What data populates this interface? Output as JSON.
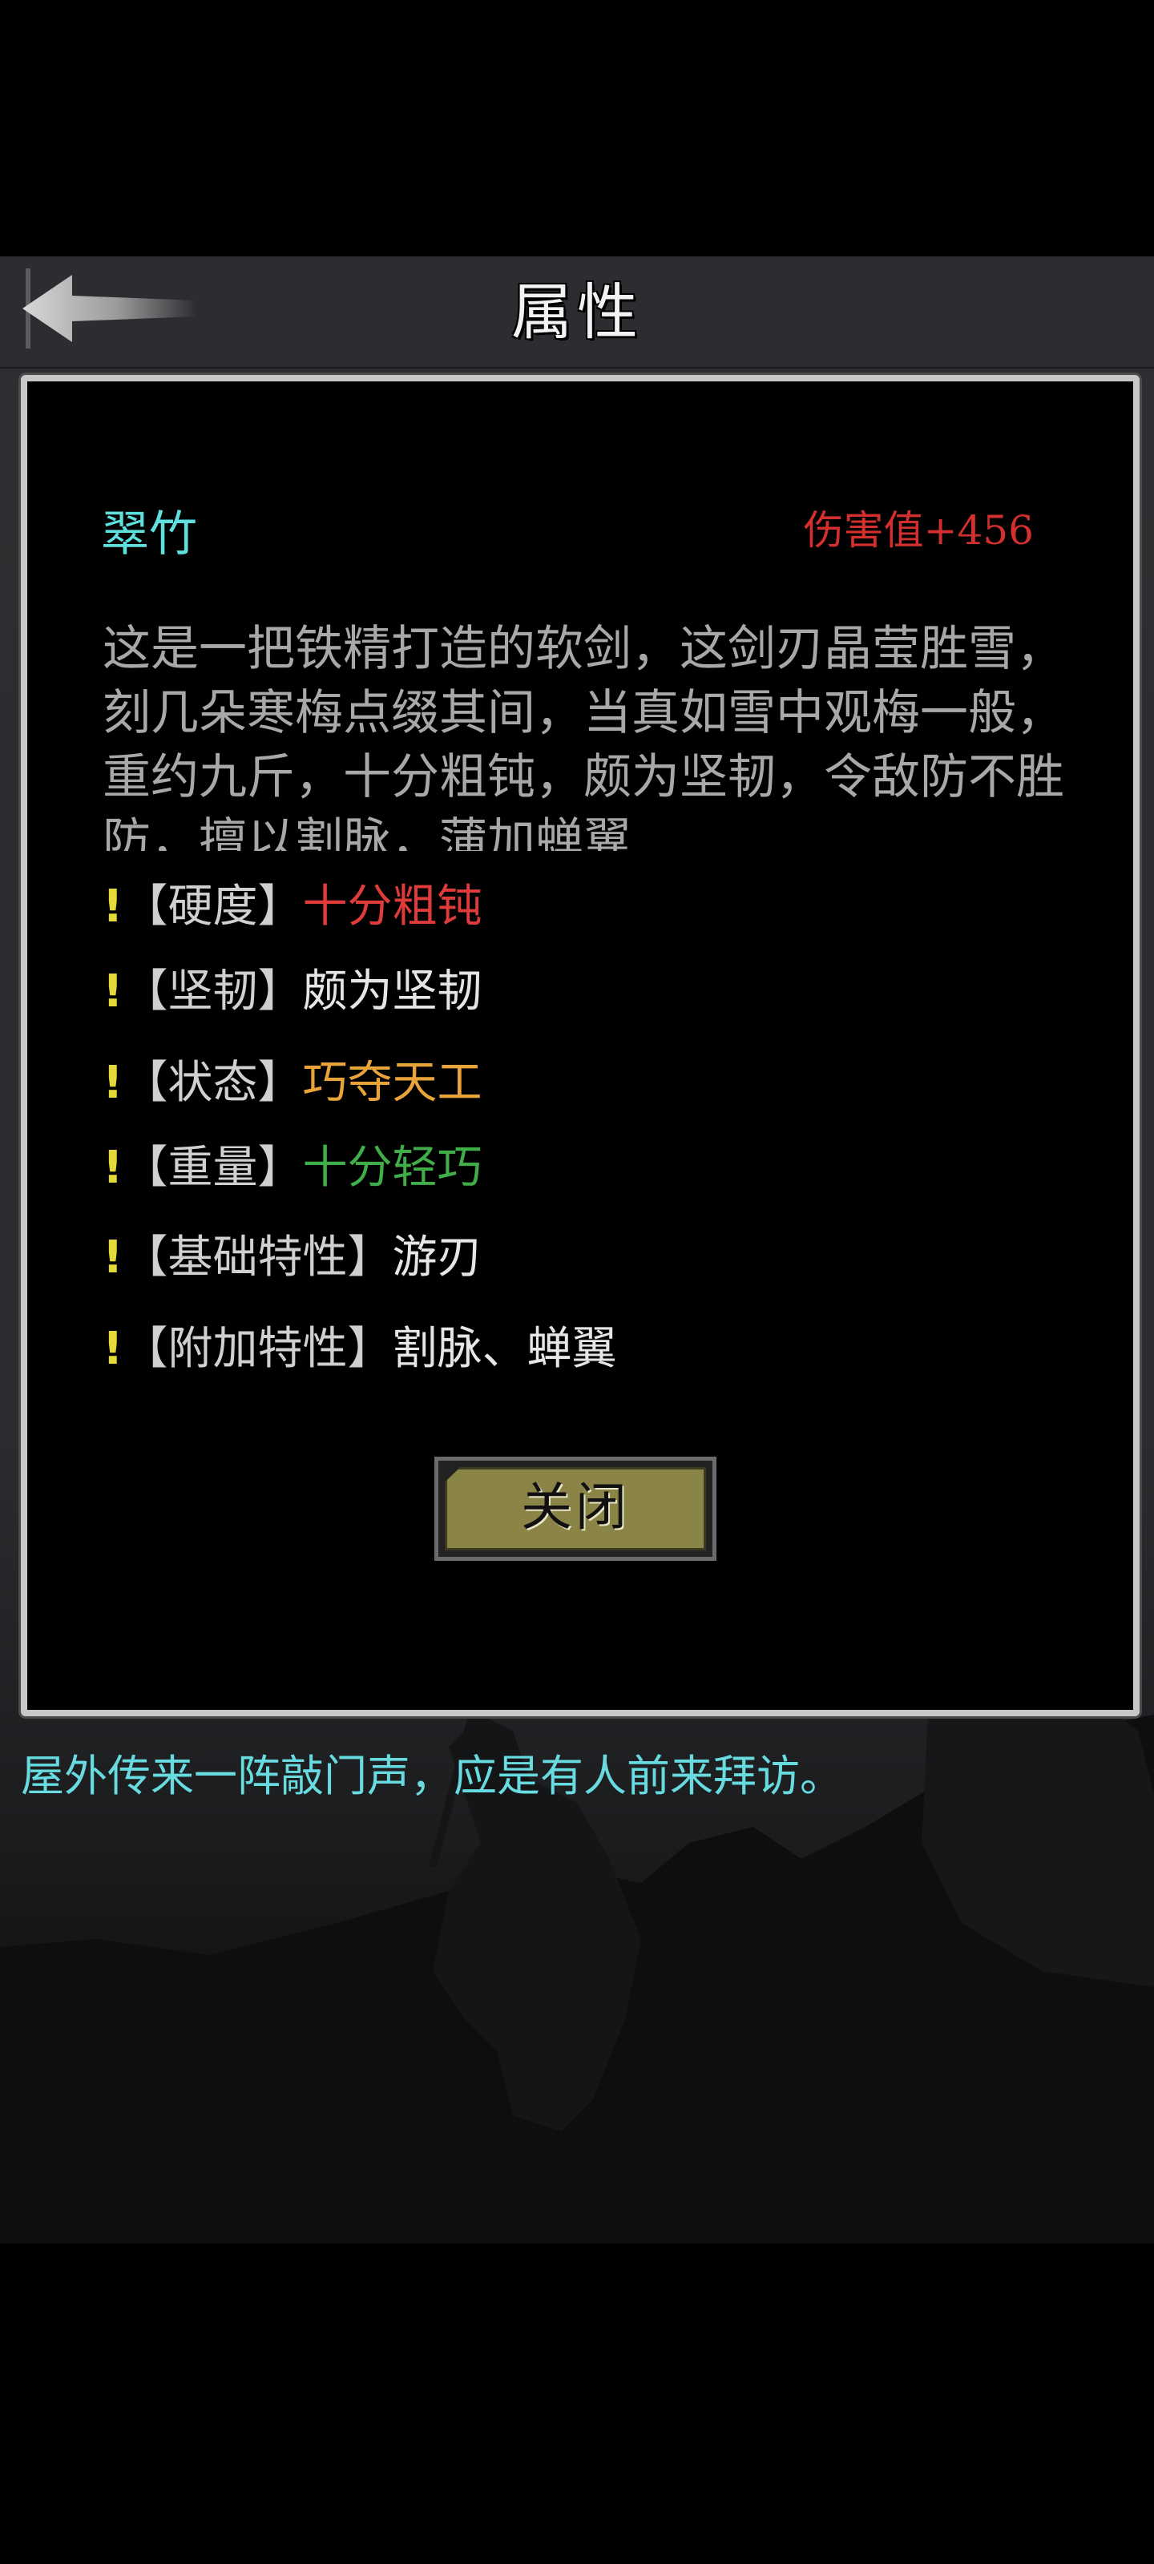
{
  "header": {
    "title": "属性"
  },
  "item": {
    "name": "翠竹",
    "damage": "伤害值+456",
    "description": "这是一把铁精打造的软剑，这剑刃晶莹胜雪，刻几朵寒梅点缀其间，当真如雪中观梅一般，重约九斤，十分粗钝，颇为坚韧，令敌防不胜防，擅以割脉，蒲加蝉翼"
  },
  "attributes": [
    {
      "mark": "!",
      "label": "【硬度】",
      "value": "十分粗钝",
      "color": "#e03b3b"
    },
    {
      "mark": "!",
      "label": "【坚韧】",
      "value": "颇为坚韧",
      "color": "#e6e6e6"
    },
    {
      "mark": "!",
      "label": "【状态】",
      "value": "巧夺天工",
      "color": "#e8a33a"
    },
    {
      "mark": "!",
      "label": "【重量】",
      "value": "十分轻巧",
      "color": "#3fae49"
    },
    {
      "mark": "!",
      "label": "【基础特性】",
      "value": "游刃",
      "color": "#e6e6e6"
    },
    {
      "mark": "!",
      "label": "【附加特性】",
      "value": "割脉、蝉翼",
      "color": "#e6e6e6"
    }
  ],
  "close_button": {
    "label": "关闭"
  },
  "message": "屋外传来一阵敲门声，应是有人前来拜访。",
  "icons": {
    "back": "back-arrow-icon"
  }
}
